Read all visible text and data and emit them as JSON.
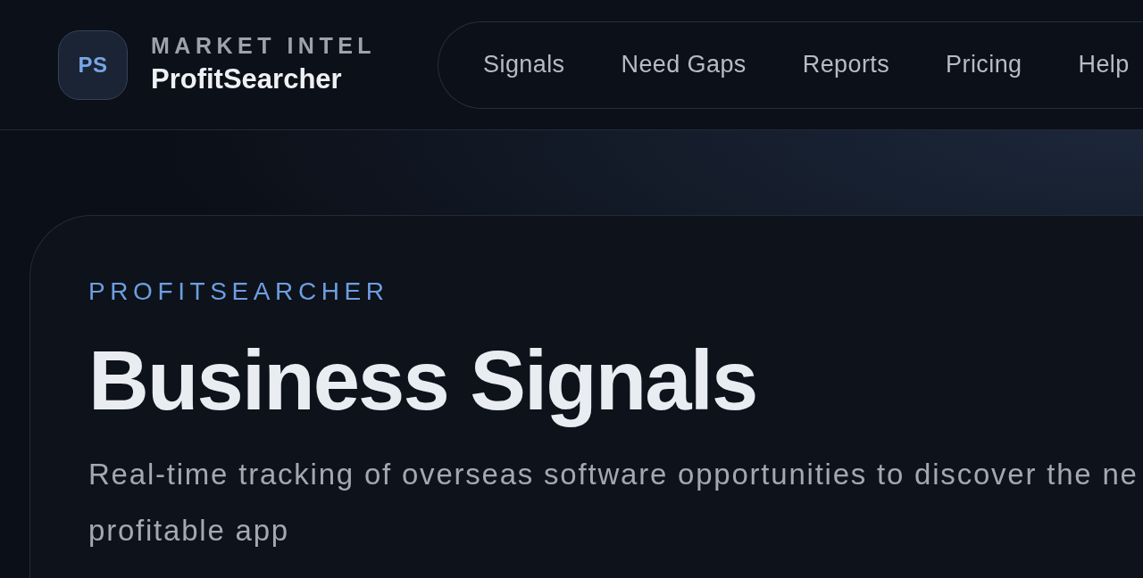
{
  "header": {
    "logo": {
      "initials": "PS"
    },
    "brand": {
      "eyebrow": "MARKET INTEL",
      "name": "ProfitSearcher"
    },
    "nav": [
      {
        "label": "Signals"
      },
      {
        "label": "Need Gaps"
      },
      {
        "label": "Reports"
      },
      {
        "label": "Pricing"
      },
      {
        "label": "Help"
      }
    ]
  },
  "hero": {
    "eyebrow": "PROFITSEARCHER",
    "title": "Business Signals",
    "description": "Real-time tracking of overseas software opportunities to discover the ne\nprofitable app"
  }
}
